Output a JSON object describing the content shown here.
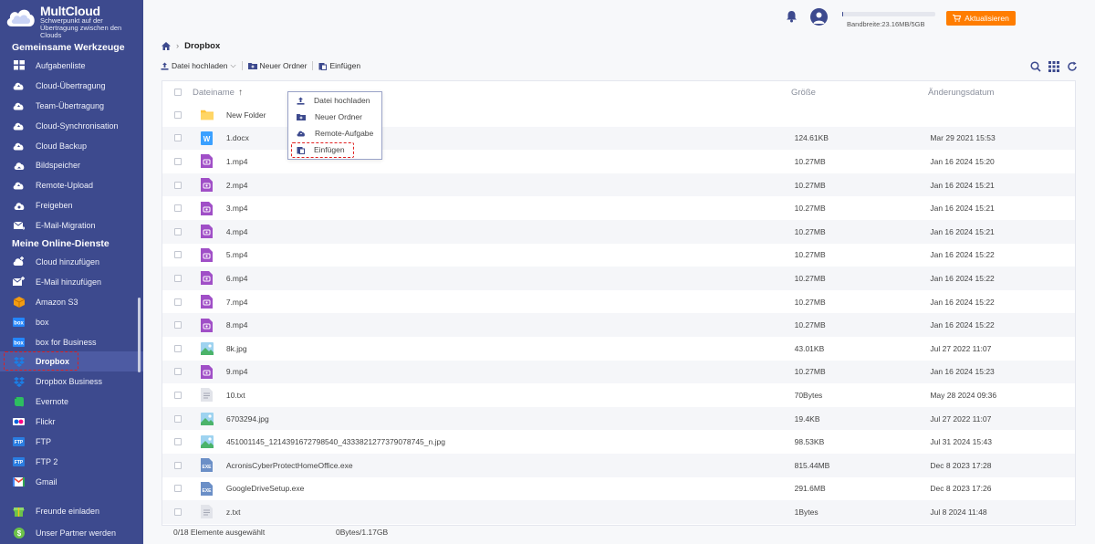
{
  "brand": {
    "title": "MultCloud",
    "subtitle": "Schwerpunkt auf der Übertragung zwischen den Clouds"
  },
  "sidebar": {
    "section1": "Gemeinsame Werkzeuge",
    "tools": [
      {
        "label": "Aufgabenliste",
        "icon": "tasklist-icon"
      },
      {
        "label": "Cloud-Übertragung",
        "icon": "cloud-transfer-icon"
      },
      {
        "label": "Team-Übertragung",
        "icon": "team-transfer-icon"
      },
      {
        "label": "Cloud-Synchronisation",
        "icon": "cloud-sync-icon"
      },
      {
        "label": "Cloud Backup",
        "icon": "cloud-backup-icon"
      },
      {
        "label": "Bildspeicher",
        "icon": "image-save-icon"
      },
      {
        "label": "Remote-Upload",
        "icon": "remote-upload-icon"
      },
      {
        "label": "Freigeben",
        "icon": "share-icon"
      },
      {
        "label": "E-Mail-Migration",
        "icon": "email-migration-icon"
      }
    ],
    "section2": "Meine Online-Dienste",
    "services": [
      {
        "label": "Cloud hinzufügen",
        "icon": "add-cloud-icon"
      },
      {
        "label": "E-Mail hinzufügen",
        "icon": "add-email-icon"
      },
      {
        "label": "Amazon S3",
        "icon": "amazon-s3-icon"
      },
      {
        "label": "box",
        "icon": "box-icon"
      },
      {
        "label": "box for Business",
        "icon": "box-business-icon"
      },
      {
        "label": "Dropbox",
        "icon": "dropbox-icon"
      },
      {
        "label": "Dropbox Business",
        "icon": "dropbox-business-icon"
      },
      {
        "label": "Evernote",
        "icon": "evernote-icon"
      },
      {
        "label": "Flickr",
        "icon": "flickr-icon"
      },
      {
        "label": "FTP",
        "icon": "ftp-icon"
      },
      {
        "label": "FTP 2",
        "icon": "ftp2-icon"
      },
      {
        "label": "Gmail",
        "icon": "gmail-icon"
      }
    ],
    "footer": [
      {
        "label": "Freunde einladen",
        "icon": "invite-icon"
      },
      {
        "label": "Unser Partner werden",
        "icon": "partner-icon"
      }
    ]
  },
  "header": {
    "bandwidth": "Bandbreite:23.16MB/5GB",
    "bandwidth_used_fraction": 0.0045,
    "upgrade_label": "Aktualisieren"
  },
  "breadcrumb": {
    "current": "Dropbox"
  },
  "toolbar": {
    "upload": "Datei hochladen",
    "new_folder": "Neuer Ordner",
    "paste": "Einfügen"
  },
  "dropdown": {
    "upload": "Datei hochladen",
    "new_folder": "Neuer Ordner",
    "remote": "Remote-Aufgabe",
    "paste": "Einfügen"
  },
  "table": {
    "col_name": "Dateiname",
    "col_size": "Größe",
    "col_date": "Änderungsdatum",
    "rows": [
      {
        "name": "New Folder",
        "size": "",
        "date": "",
        "type": "folder"
      },
      {
        "name": "1.docx",
        "size": "124.61KB",
        "date": "Mar 29 2021 15:53",
        "type": "doc"
      },
      {
        "name": "1.mp4",
        "size": "10.27MB",
        "date": "Jan 16 2024 15:20",
        "type": "video"
      },
      {
        "name": "2.mp4",
        "size": "10.27MB",
        "date": "Jan 16 2024 15:21",
        "type": "video"
      },
      {
        "name": "3.mp4",
        "size": "10.27MB",
        "date": "Jan 16 2024 15:21",
        "type": "video"
      },
      {
        "name": "4.mp4",
        "size": "10.27MB",
        "date": "Jan 16 2024 15:21",
        "type": "video"
      },
      {
        "name": "5.mp4",
        "size": "10.27MB",
        "date": "Jan 16 2024 15:22",
        "type": "video"
      },
      {
        "name": "6.mp4",
        "size": "10.27MB",
        "date": "Jan 16 2024 15:22",
        "type": "video"
      },
      {
        "name": "7.mp4",
        "size": "10.27MB",
        "date": "Jan 16 2024 15:22",
        "type": "video"
      },
      {
        "name": "8.mp4",
        "size": "10.27MB",
        "date": "Jan 16 2024 15:22",
        "type": "video"
      },
      {
        "name": "8k.jpg",
        "size": "43.01KB",
        "date": "Jul 27 2022 11:07",
        "type": "image"
      },
      {
        "name": "9.mp4",
        "size": "10.27MB",
        "date": "Jan 16 2024 15:23",
        "type": "video"
      },
      {
        "name": "10.txt",
        "size": "70Bytes",
        "date": "May 28 2024 09:36",
        "type": "text"
      },
      {
        "name": "6703294.jpg",
        "size": "19.4KB",
        "date": "Jul 27 2022 11:07",
        "type": "image"
      },
      {
        "name": "451001145_1214391672798540_4333821277379078745_n.jpg",
        "size": "98.53KB",
        "date": "Jul 31 2024 15:43",
        "type": "image"
      },
      {
        "name": "AcronisCyberProtectHomeOffice.exe",
        "size": "815.44MB",
        "date": "Dec 8 2023 17:28",
        "type": "exe"
      },
      {
        "name": "GoogleDriveSetup.exe",
        "size": "291.6MB",
        "date": "Dec 8 2023 17:26",
        "type": "exe"
      },
      {
        "name": "z.txt",
        "size": "1Bytes",
        "date": "Jul 8 2024 11:48",
        "type": "text"
      }
    ]
  },
  "status": {
    "selected": "0/18 Elemente ausgewählt",
    "size": "0Bytes/1.17GB"
  },
  "colors": {
    "sidebar": "#3d4a8e",
    "accent": "#ff7d00",
    "highlight": "#e02020"
  }
}
